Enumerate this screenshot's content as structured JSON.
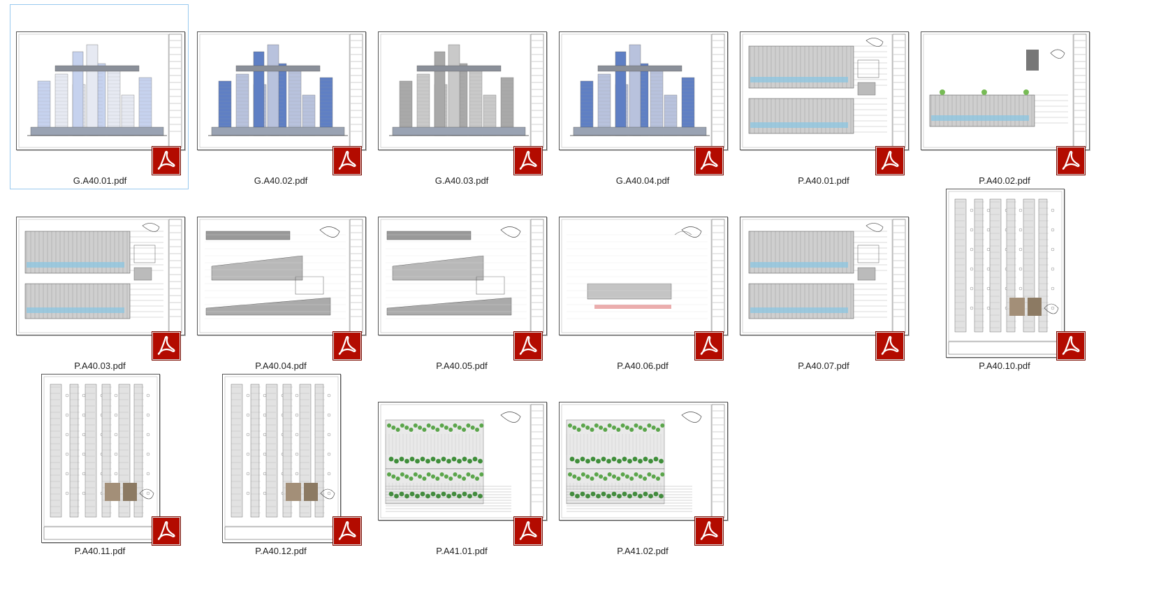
{
  "files": [
    {
      "name": "G.A40.01.pdf",
      "orientation": "land",
      "style": "tower-light",
      "selected": true
    },
    {
      "name": "G.A40.02.pdf",
      "orientation": "land",
      "style": "tower-blue",
      "selected": false
    },
    {
      "name": "G.A40.03.pdf",
      "orientation": "land",
      "style": "tower-gray",
      "selected": false
    },
    {
      "name": "G.A40.04.pdf",
      "orientation": "land",
      "style": "tower-blue2",
      "selected": false
    },
    {
      "name": "P.A40.01.pdf",
      "orientation": "land",
      "style": "elev-double",
      "selected": false
    },
    {
      "name": "P.A40.02.pdf",
      "orientation": "land",
      "style": "elev-single",
      "selected": false
    },
    {
      "name": "P.A40.03.pdf",
      "orientation": "land",
      "style": "elev-double",
      "selected": false
    },
    {
      "name": "P.A40.04.pdf",
      "orientation": "land",
      "style": "section",
      "selected": false
    },
    {
      "name": "P.A40.05.pdf",
      "orientation": "land",
      "style": "section",
      "selected": false
    },
    {
      "name": "P.A40.06.pdf",
      "orientation": "land",
      "style": "section-sparse",
      "selected": false
    },
    {
      "name": "P.A40.07.pdf",
      "orientation": "land",
      "style": "elev-double",
      "selected": false
    },
    {
      "name": "P.A40.10.pdf",
      "orientation": "port",
      "style": "portrait",
      "selected": false
    },
    {
      "name": "P.A40.11.pdf",
      "orientation": "port",
      "style": "portrait",
      "selected": false
    },
    {
      "name": "P.A40.12.pdf",
      "orientation": "port",
      "style": "portrait",
      "selected": false
    },
    {
      "name": "P.A41.01.pdf",
      "orientation": "land",
      "style": "green",
      "selected": false
    },
    {
      "name": "P.A41.02.pdf",
      "orientation": "land",
      "style": "green",
      "selected": false
    }
  ],
  "icons": {
    "file_type_icon": "acrobat-pdf-icon"
  },
  "colors": {
    "selection_border": "#99c9ef",
    "pdf_badge": "#b30b00",
    "label_text": "#1e1e1e"
  }
}
